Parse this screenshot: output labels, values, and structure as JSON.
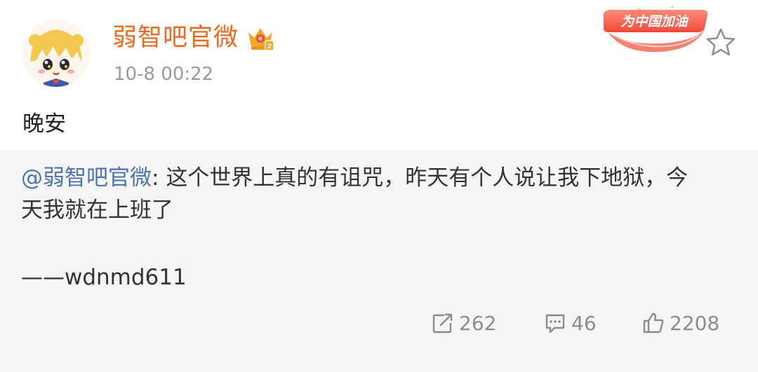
{
  "header": {
    "username": "弱智吧官微",
    "timestamp": "10-8 00:22",
    "badge_text": "为中国加油"
  },
  "post": {
    "text": "晚安"
  },
  "repost": {
    "mention": "@弱智吧官微",
    "separator": ": ",
    "content": "这个世界上真的有诅咒，昨天有个人说让我下地狱，今天我就在上班了",
    "signature": "——wdnmd611"
  },
  "actions": {
    "reposts": "262",
    "comments": "46",
    "likes": "2208"
  },
  "colors": {
    "username": "#f0671e",
    "mention": "#4e74b3",
    "repost_bg": "#f5f5f5"
  }
}
